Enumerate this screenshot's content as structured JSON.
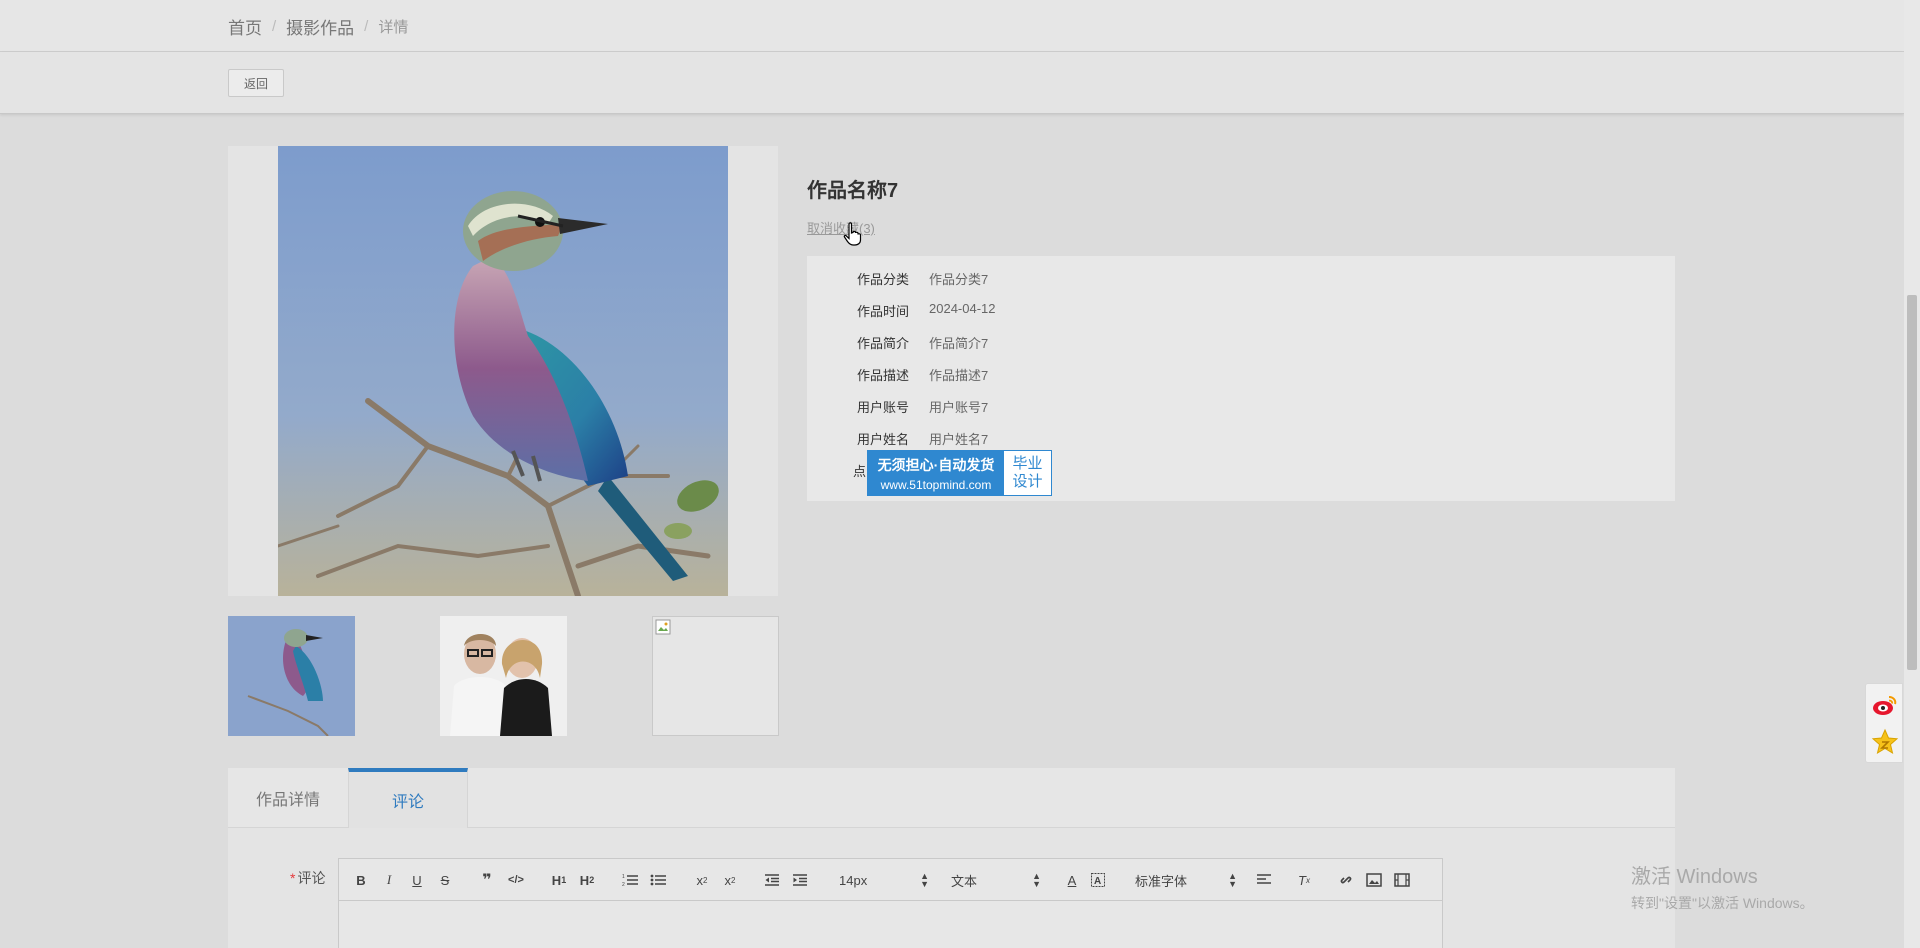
{
  "breadcrumb": {
    "items": [
      "首页",
      "摄影作品",
      "详情"
    ],
    "separator": "/"
  },
  "toolbar": {
    "back_label": "返回"
  },
  "work": {
    "title": "作品名称7",
    "favorite_link": "取消收藏(3)",
    "fields": [
      {
        "label": "作品分类",
        "value": "作品分类7"
      },
      {
        "label": "作品时间",
        "value": "2024-04-12"
      },
      {
        "label": "作品简介",
        "value": "作品简介7"
      },
      {
        "label": "作品描述",
        "value": "作品描述7"
      },
      {
        "label": "用户账号",
        "value": "用户账号7"
      },
      {
        "label": "用户姓名",
        "value": "用户姓名7"
      },
      {
        "label": "点"
      }
    ]
  },
  "ad": {
    "line1": "无须担心·自动发货",
    "line2": "www.51topmind.com",
    "right_top": "毕业",
    "right_bottom": "设计"
  },
  "tabs": [
    {
      "label": "作品详情",
      "active": false
    },
    {
      "label": "评论",
      "active": true
    }
  ],
  "comment_form": {
    "required_mark": "*",
    "label": "评论",
    "font_size": "14px",
    "block_type": "文本",
    "font_family": "标准字体"
  },
  "icons": {
    "share": [
      "weibo-icon",
      "favorite-star-icon"
    ],
    "cursor": "hand-cursor-icon"
  },
  "watermark": {
    "line1": "激活 Windows",
    "line2": "转到\"设置\"以激活 Windows。"
  },
  "colors": {
    "accent": "#2f7bbf",
    "required": "#e4393c",
    "ad_blue": "#2f88d0"
  }
}
